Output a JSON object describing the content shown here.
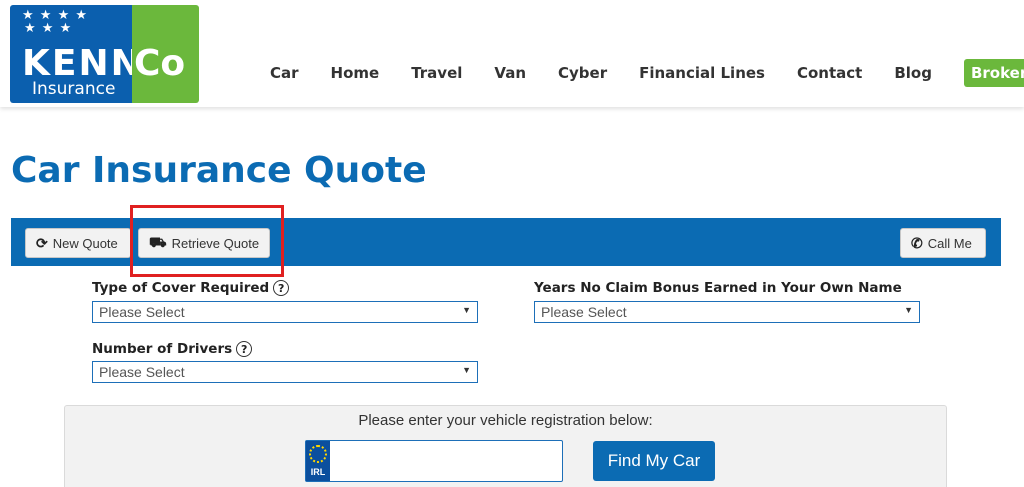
{
  "brand": {
    "logo_main": "KENN",
    "logo_co": "Co",
    "logo_sub": "Insurance",
    "colors": {
      "blue": "#0b5fae",
      "green": "#6bb83c"
    }
  },
  "nav": {
    "items": [
      "Car",
      "Home",
      "Travel",
      "Van",
      "Cyber",
      "Financial Lines",
      "Contact",
      "Blog"
    ],
    "brokers": "Brokers"
  },
  "page": {
    "title": "Car Insurance Quote"
  },
  "toolbar": {
    "new_quote": "New Quote",
    "retrieve_quote": "Retrieve Quote",
    "call_me": "Call Me"
  },
  "form": {
    "cover": {
      "label": "Type of Cover Required",
      "value": "Please Select"
    },
    "ncb": {
      "label": "Years No Claim Bonus Earned in Your Own Name",
      "value": "Please Select"
    },
    "drivers": {
      "label": "Number of Drivers",
      "value": "Please Select"
    }
  },
  "registration": {
    "prompt": "Please enter your vehicle registration below:",
    "plate_country": "IRL",
    "value": "",
    "find_button": "Find My Car"
  }
}
